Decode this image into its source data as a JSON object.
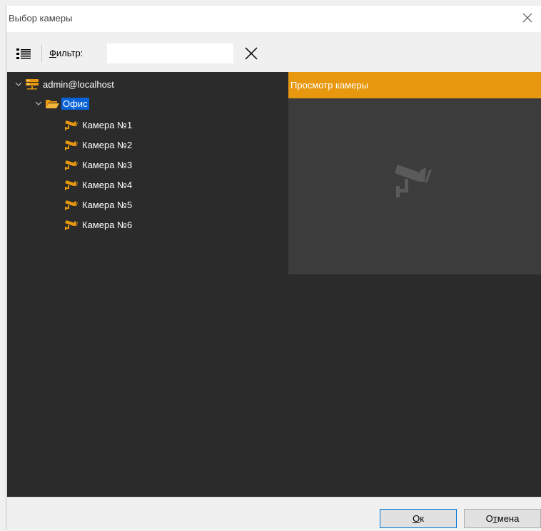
{
  "window": {
    "title": "Выбор камеры"
  },
  "toolbar": {
    "filter_label_mnemonic": "Ф",
    "filter_label_rest": "ильтр:",
    "filter_value": ""
  },
  "tree": {
    "server": "admin@localhost",
    "group": "Офис",
    "cameras": [
      "Камера №1",
      "Камера №2",
      "Камера №3",
      "Камера №4",
      "Камера №5",
      "Камера №6"
    ]
  },
  "preview": {
    "title": "Просмотр камеры"
  },
  "footer": {
    "ok_mnemonic": "О",
    "ok_rest": "к",
    "cancel_first": "О",
    "cancel_mnemonic": "т",
    "cancel_rest": "мена"
  },
  "colors": {
    "accent": "#e8980f",
    "selection": "#0a64d8",
    "panel_bg": "#2b2b2b",
    "preview_bg": "#3c3c3c"
  }
}
